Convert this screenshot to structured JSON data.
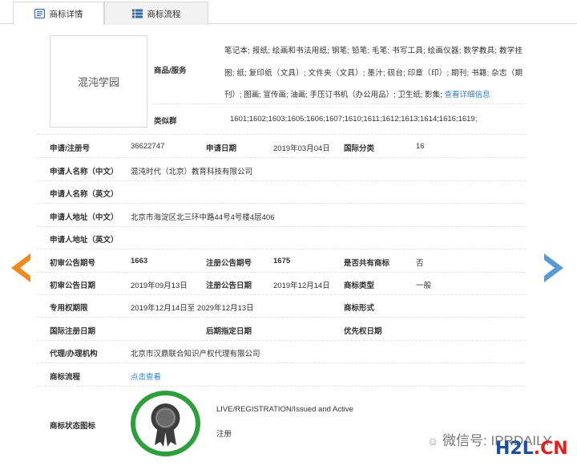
{
  "tabs": [
    {
      "label": "商标详情",
      "active": true,
      "icon": "document-icon"
    },
    {
      "label": "商标流程",
      "active": false,
      "icon": "list-icon"
    }
  ],
  "logo_text": "混沌学园",
  "goods_services": {
    "label": "商品/服务",
    "text": "笔记本; 报纸; 绘画和书法用纸; 钢笔; 铅笔; 毛笔; 书写工具; 绘画仪器; 数学教具; 教学挂图; 纸; 复印纸（文具）; 文件夹（文具）; 墨汁; 砚台; 印章（印）; 期刊; 书籍; 杂志（期刊）; 图画; 宣传画; 油画; 手压订书机（办公用品）; 卫生纸; 影集;",
    "link": "查看详细信息"
  },
  "similar_groups": {
    "label": "类似群",
    "value": "1601;1602;1603;1605;1606;1607;1610;1611;1612;1613;1614;1616;1619;"
  },
  "rows": {
    "reg_no": {
      "label": "申请/注册号",
      "value": "36622747"
    },
    "apply_date": {
      "label": "申请日期",
      "value": "2019年03月04日"
    },
    "intl_class": {
      "label": "国际分类",
      "value": "16"
    },
    "applicant_cn": {
      "label": "申请人名称（中文）",
      "value": "混沌时代（北京）教育科技有限公司"
    },
    "applicant_en": {
      "label": "申请人名称（英文）",
      "value": ""
    },
    "address_cn": {
      "label": "申请人地址（中文）",
      "value": "北京市海淀区北三环中路44号4号楼4层406"
    },
    "address_en": {
      "label": "申请人地址（英文）",
      "value": ""
    },
    "prelim_no": {
      "label": "初审公告期号",
      "value": "1663"
    },
    "reg_pub_no": {
      "label": "注册公告期号",
      "value": "1675"
    },
    "shared": {
      "label": "是否共有商标",
      "value": "否"
    },
    "prelim_date": {
      "label": "初审公告日期",
      "value": "2019年09月13日"
    },
    "reg_pub_date": {
      "label": "注册公告日期",
      "value": "2019年12月14日"
    },
    "tm_type": {
      "label": "商标类型",
      "value": "一般"
    },
    "exclusive_period": {
      "label": "专用权期限",
      "value": "2019年12月14日至 2029年12月13日"
    },
    "tm_form": {
      "label": "商标形式",
      "value": ""
    },
    "intl_reg_date": {
      "label": "国际注册日期",
      "value": ""
    },
    "later_date": {
      "label": "后期指定日期",
      "value": ""
    },
    "priority_date": {
      "label": "优先权日期",
      "value": ""
    },
    "agent": {
      "label": "代理/办理机构",
      "value": "北京市汉鼎联合知识产权代理有限公司"
    },
    "flow": {
      "label": "商标流程",
      "link": "点击查看"
    },
    "status": {
      "label": "商标状态图标",
      "status_en": "LIVE/REGISTRATION/Issued and Active",
      "status_cn": "注册"
    }
  },
  "watermark": {
    "wechat": "微信号: IPRDAILY",
    "site_a": "H2L",
    "site_b": ".CN"
  },
  "colors": {
    "accent": "#2e7fc9",
    "arrow_left": "#f08a1c",
    "arrow_right": "#5b9bd5",
    "badge_green": "#2f9e3c"
  }
}
